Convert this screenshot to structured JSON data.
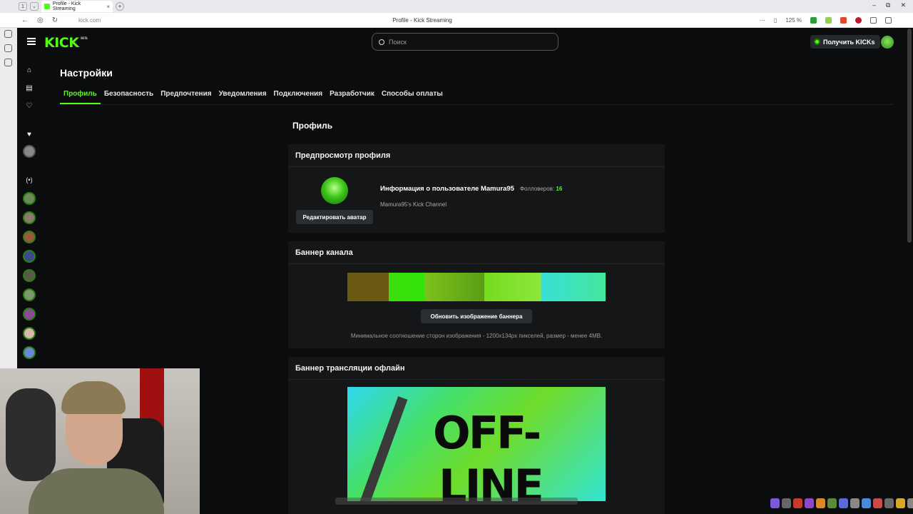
{
  "browser": {
    "tab_title": "Profile - Kick Streaming",
    "tab_numbers": [
      "1"
    ],
    "url": "kick.com",
    "window_title": "Profile - Kick Streaming",
    "zoom": "125 %"
  },
  "header": {
    "logo": "KICK",
    "logo_badge": "BETA",
    "search_placeholder": "Поиск",
    "get_kicks_label": "Получить KICKs"
  },
  "settings": {
    "title": "Настройки",
    "tabs": [
      {
        "label": "Профиль",
        "active": true
      },
      {
        "label": "Безопасность"
      },
      {
        "label": "Предпочтения"
      },
      {
        "label": "Уведомления"
      },
      {
        "label": "Подключения"
      },
      {
        "label": "Разработчик"
      },
      {
        "label": "Способы оплаты"
      }
    ]
  },
  "profile": {
    "section_title": "Профиль",
    "preview": {
      "title": "Предпросмотр профиля",
      "user_info": "Информация о пользователе Mamura95",
      "followers_label": "Фолловеров:",
      "followers_count": "16",
      "channel_sub": "Mamura95's Kick Channel",
      "edit_avatar_button": "Редактировать аватар"
    },
    "channel_banner": {
      "title": "Баннер канала",
      "update_button": "Обновить изображение баннера",
      "hint": "Минимальное соотношение сторон изображения - 1200x134px пикселей, размер - менее 4MB."
    },
    "offline_banner": {
      "title": "Баннер трансляции офлайн",
      "image_text_line1": "OFF-",
      "image_text_line2": "LINE"
    }
  },
  "colors": {
    "accent": "#53fc18",
    "background": "#0b0c0d",
    "card": "#141618"
  }
}
